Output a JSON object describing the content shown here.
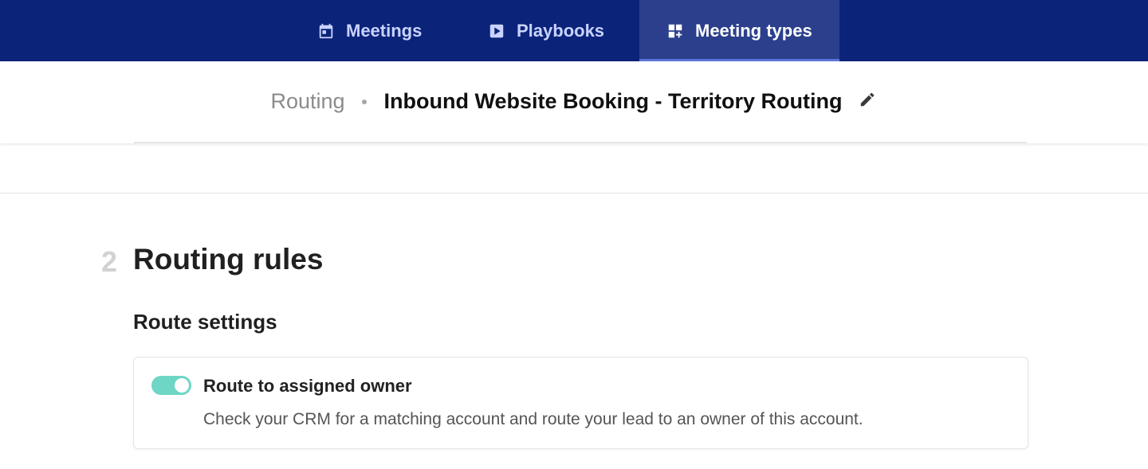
{
  "nav": {
    "tabs": [
      {
        "label": "Meetings",
        "icon": "calendar-icon",
        "active": false
      },
      {
        "label": "Playbooks",
        "icon": "play-icon",
        "active": false
      },
      {
        "label": "Meeting types",
        "icon": "grid-plus-icon",
        "active": true
      }
    ]
  },
  "header": {
    "breadcrumb": "Routing",
    "title": "Inbound Website Booking - Territory Routing",
    "edit_icon": "pencil-icon"
  },
  "section": {
    "number": "2",
    "title": "Routing rules",
    "subtitle": "Route settings",
    "option": {
      "title": "Route to assigned owner",
      "description": "Check your CRM for a matching account and route your lead to an owner of this account.",
      "enabled": true
    }
  },
  "colors": {
    "nav_bg": "#0b2379",
    "nav_active_bg": "#2b3f8c",
    "toggle_on": "#6dd6c4"
  }
}
